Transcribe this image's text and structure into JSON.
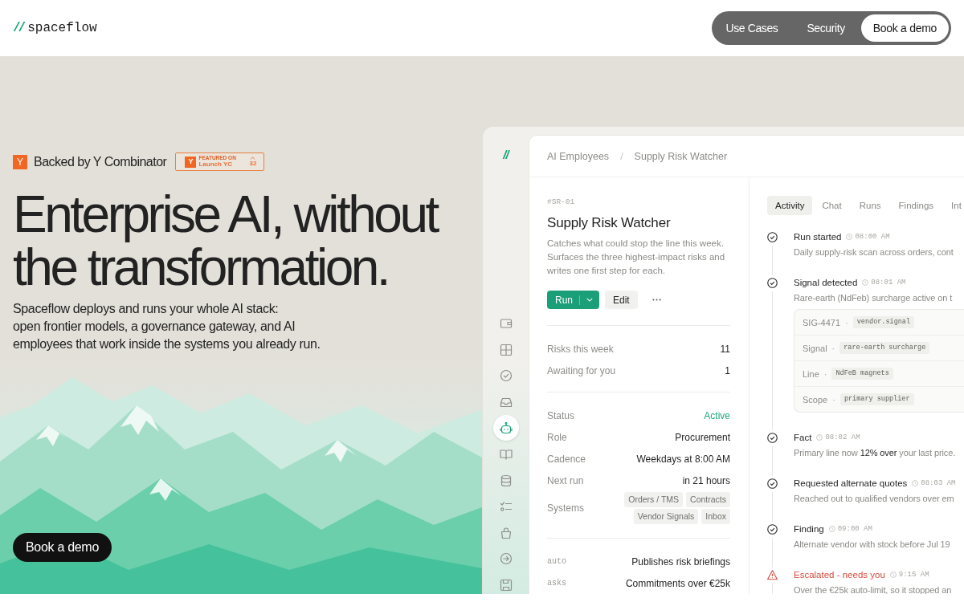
{
  "header": {
    "logo_mark": "//",
    "logo_text": "spaceflow",
    "nav": [
      {
        "label": "Use Cases",
        "kind": "link"
      },
      {
        "label": "Security",
        "kind": "link"
      },
      {
        "label": "Book a demo",
        "kind": "cta"
      }
    ]
  },
  "hero": {
    "backed_by": {
      "logo_letter": "Y",
      "text": "Backed by Y Combinator"
    },
    "launch_badge": {
      "logo_letter": "Y",
      "caption": "FEATURED ON",
      "name": "Launch YC",
      "count": "32"
    },
    "heading": "Enterprise AI, without the transformation.",
    "description": "Spaceflow deploys and runs your whole AI stack:\nopen frontier models, a governance gateway, and AI\nemployees that work inside the systems you already run.",
    "cta": "Book a demo"
  },
  "app": {
    "logo_mark": "//",
    "sidebar": {
      "items": [
        {
          "selected": false
        },
        {
          "selected": false
        },
        {
          "selected": false
        },
        {
          "selected": false
        },
        {
          "selected": true
        },
        {
          "selected": false
        },
        {
          "selected": false
        },
        {
          "selected": false
        },
        {
          "selected": false
        },
        {
          "selected": false
        },
        {
          "selected": false
        }
      ]
    },
    "breadcrumb": {
      "items": [
        "AI Employees",
        "Supply Risk Watcher"
      ],
      "separator": "/"
    },
    "agent": {
      "id": "#SR-01",
      "name": "Supply Risk Watcher",
      "description": "Catches what could stop the line this week.\nSurfaces the three highest-impact risks and\nwrites one first step for each.",
      "actions": [
        {
          "kind": "split",
          "label": "Run"
        },
        {
          "kind": "secondary",
          "label": "Edit"
        },
        {
          "kind": "more"
        }
      ]
    },
    "stats": [
      {
        "label": "Risks this week",
        "value": "11"
      },
      {
        "label": "Awaiting for you",
        "value": "1"
      }
    ],
    "details": [
      {
        "label": "Status",
        "kind": "status",
        "value": "Active"
      },
      {
        "label": "Role",
        "kind": "text",
        "value": "Procurement"
      },
      {
        "label": "Cadence",
        "kind": "text",
        "value": "Weekdays at 8:00 AM"
      },
      {
        "label": "Next run",
        "kind": "text",
        "value": "in 21 hours"
      },
      {
        "label": "Systems",
        "kind": "tags",
        "tags": [
          "Orders / TMS",
          "Contracts",
          "Vendor Signals",
          "Inbox"
        ]
      }
    ],
    "permissions": [
      {
        "mode": "auto",
        "value": "Publishes risk briefings"
      },
      {
        "mode": "asks",
        "value": "Commitments over €25k"
      }
    ],
    "tabs": [
      {
        "label": "Activity",
        "selected": true
      },
      {
        "label": "Chat",
        "selected": false
      },
      {
        "label": "Runs",
        "selected": false
      },
      {
        "label": "Findings",
        "selected": false
      },
      {
        "label": "Int",
        "selected": false
      }
    ],
    "activity": [
      {
        "kind": "done",
        "title": "Run started",
        "time": "08:00 AM",
        "text": "Daily supply-risk scan across orders, cont"
      },
      {
        "kind": "done",
        "title": "Signal detected",
        "time": "08:01 AM",
        "text": "Rare-earth (NdFeb) surcharge active on t",
        "field_separator": "·",
        "fields": [
          {
            "label": "SIG-4471",
            "value": "vendor.signal"
          },
          {
            "label": "Signal",
            "value": "rare-earth surcharge"
          },
          {
            "label": "Line",
            "value": "NdFeB magnets"
          },
          {
            "label": "Scope",
            "value": "primary supplier"
          }
        ]
      },
      {
        "kind": "done",
        "title": "Fact",
        "time": "08:02 AM",
        "text": "Primary line now **12% over** your last price."
      },
      {
        "kind": "done",
        "title": "Requested alternate quotes",
        "time": "08:03 AM",
        "text": "Reached out to qualified vendors over em"
      },
      {
        "kind": "done",
        "title": "Finding",
        "time": "09:00 AM",
        "text": "Alternate vendor with stock before Jul 19"
      },
      {
        "kind": "escalated",
        "title": "Escalated - needs you",
        "time": "9:15 AM",
        "text": "Over the €25k auto-limit, so it stopped an"
      }
    ]
  }
}
